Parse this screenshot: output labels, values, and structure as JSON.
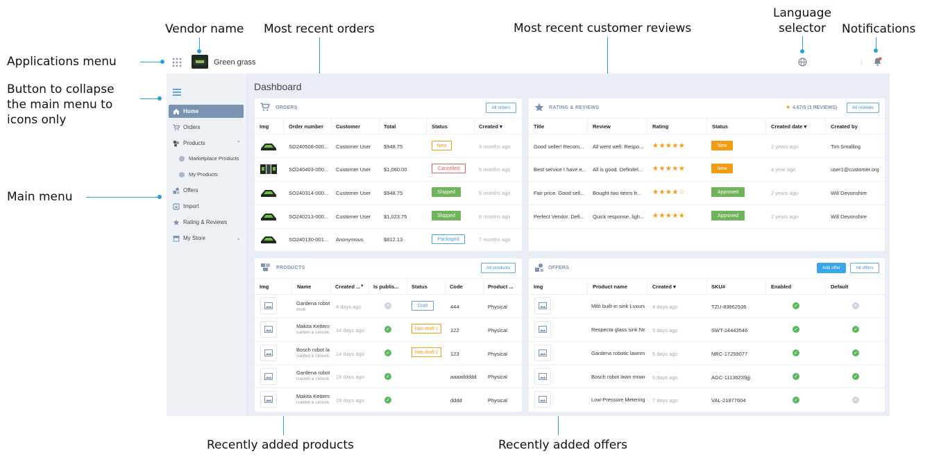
{
  "annotations": {
    "vendor_name": "Vendor name",
    "most_recent_orders": "Most recent orders",
    "most_recent_reviews": "Most recent customer reviews",
    "language_selector_1": "Language",
    "language_selector_2": "selector",
    "notifications": "Notifications",
    "applications_menu": "Applications menu",
    "collapse_1": "Button to collapse",
    "collapse_2": "the main menu to",
    "collapse_3": "icons only",
    "main_menu": "Main menu",
    "recent_products": "Recently added products",
    "recent_offers": "Recently added offers"
  },
  "topbar": {
    "vendor": "Green grass",
    "separator": "|"
  },
  "sidebar": {
    "items": [
      {
        "label": "Home"
      },
      {
        "label": "Orders"
      },
      {
        "label": "Products"
      },
      {
        "label": "Marketplace Products"
      },
      {
        "label": "My Products"
      },
      {
        "label": "Offers"
      },
      {
        "label": "Import"
      },
      {
        "label": "Rating & Reviews"
      },
      {
        "label": "My Store"
      }
    ]
  },
  "page_title": "Dashboard",
  "orders": {
    "title": "ORDERS",
    "button": "All orders",
    "columns": [
      "Img",
      "Order number",
      "Customer",
      "Total",
      "Status",
      "Created ▾"
    ],
    "rows": [
      {
        "order": "SO240508-000...",
        "customer": "Customer User",
        "total": "$948.75",
        "status": "New",
        "created": "3 months ago"
      },
      {
        "order": "SO240403-000...",
        "customer": "Customer User",
        "total": "$1,060.00",
        "status": "Cancelled",
        "created": "5 months ago"
      },
      {
        "order": "SO240314-000...",
        "customer": "Customer User",
        "total": "$948.75",
        "status": "Shipped",
        "created": "5 months ago"
      },
      {
        "order": "SO240213-000...",
        "customer": "Customer User",
        "total": "$1,023.75",
        "status": "Shipped",
        "created": "6 months ago"
      },
      {
        "order": "SO240130-001...",
        "customer": "Anonymous",
        "total": "$812.13",
        "status": "Packaged",
        "created": "7 months ago"
      }
    ]
  },
  "reviews": {
    "title": "RATING & REVIEWS",
    "summary": "4.67/5 (3 REVIEWS)",
    "button": "All reviews",
    "columns": [
      "Title",
      "Review",
      "Rating",
      "Status",
      "Created date ▾",
      "Created by"
    ],
    "rows": [
      {
        "title": "Good seller! Recom...",
        "review": "All went well. Respo...",
        "rating": 5,
        "status": "New",
        "date": "2 years ago",
        "by": "Tim Smalling"
      },
      {
        "title": "Best service I have e...",
        "review": "All is good. Definitel...",
        "rating": 5,
        "status": "New",
        "date": "a year ago",
        "by": "user1@customer.org"
      },
      {
        "title": "Fair price. Good sell...",
        "review": "Bought two items fr...",
        "rating": 4,
        "status": "Approved",
        "date": "2 years ago",
        "by": "Will Devonshire"
      },
      {
        "title": "Perfect Vendor. Defi...",
        "review": "Quick response, ligh...",
        "rating": 5,
        "status": "Approved",
        "date": "2 years ago",
        "by": "Will Devonshire"
      }
    ]
  },
  "products": {
    "title": "PRODUCTS",
    "button": "All products",
    "columns": [
      "Img",
      "Name",
      "Created ...",
      "Is publis...",
      "Status",
      "Code",
      "Product ..."
    ],
    "rows": [
      {
        "name": "Gardena roboti",
        "sub": "Build",
        "created": "4 days ago",
        "published": false,
        "status": "Draft",
        "code": "444",
        "type": "Physical"
      },
      {
        "name": "Makita Kettens",
        "sub": "Garden & Leisure,",
        "created": "14 days ago",
        "published": true,
        "status": "Has draft c",
        "code": "122",
        "type": "Physical"
      },
      {
        "name": "Bosch robot lav",
        "sub": "Garden & Leisure,",
        "created": "14 days ago",
        "published": true,
        "status": "Has draft c",
        "code": "123",
        "type": "Physical"
      },
      {
        "name": "Gardena roboti",
        "sub": "Garden & Leisure,",
        "created": "18 days ago",
        "published": true,
        "status": "",
        "code": "aaaaddddd",
        "type": "Physical"
      },
      {
        "name": "Makita Kettens",
        "sub": "Garden & Leisure,",
        "created": "19 days ago",
        "published": true,
        "status": "",
        "code": "dddd",
        "type": "Physical"
      }
    ]
  },
  "offers": {
    "title": "OFFERS",
    "add_button": "Add offer",
    "button": "All offers",
    "columns": [
      "Img",
      "Product name",
      "Created ▾",
      "SKU#",
      "Enabled",
      "Default"
    ],
    "rows": [
      {
        "name": "Miló built-in sink Luxuria",
        "created": "4 days ago",
        "sku": "TZU-83962536",
        "enabled": true,
        "default": false
      },
      {
        "name": "Respecta glass sink Nev",
        "created": "5 days ago",
        "sku": "SWT-24443546",
        "enabled": true,
        "default": true
      },
      {
        "name": "Gardena robotic lawnmc",
        "created": "5 days ago",
        "sku": "NRC-17259077",
        "enabled": true,
        "default": true
      },
      {
        "name": "Bosch robot lawn mowe",
        "created": "5 days ago",
        "sku": "AGC-11136239jjj",
        "enabled": true,
        "default": true
      },
      {
        "name": "Low-Pressure Metering",
        "created": "7 days ago",
        "sku": "VAL-21877604",
        "enabled": true,
        "default": false
      }
    ]
  },
  "colors": {
    "accent": "#2a9fd6",
    "sidebar_active": "#7a93b3",
    "star": "#f39c12",
    "success": "#6fb35a"
  }
}
